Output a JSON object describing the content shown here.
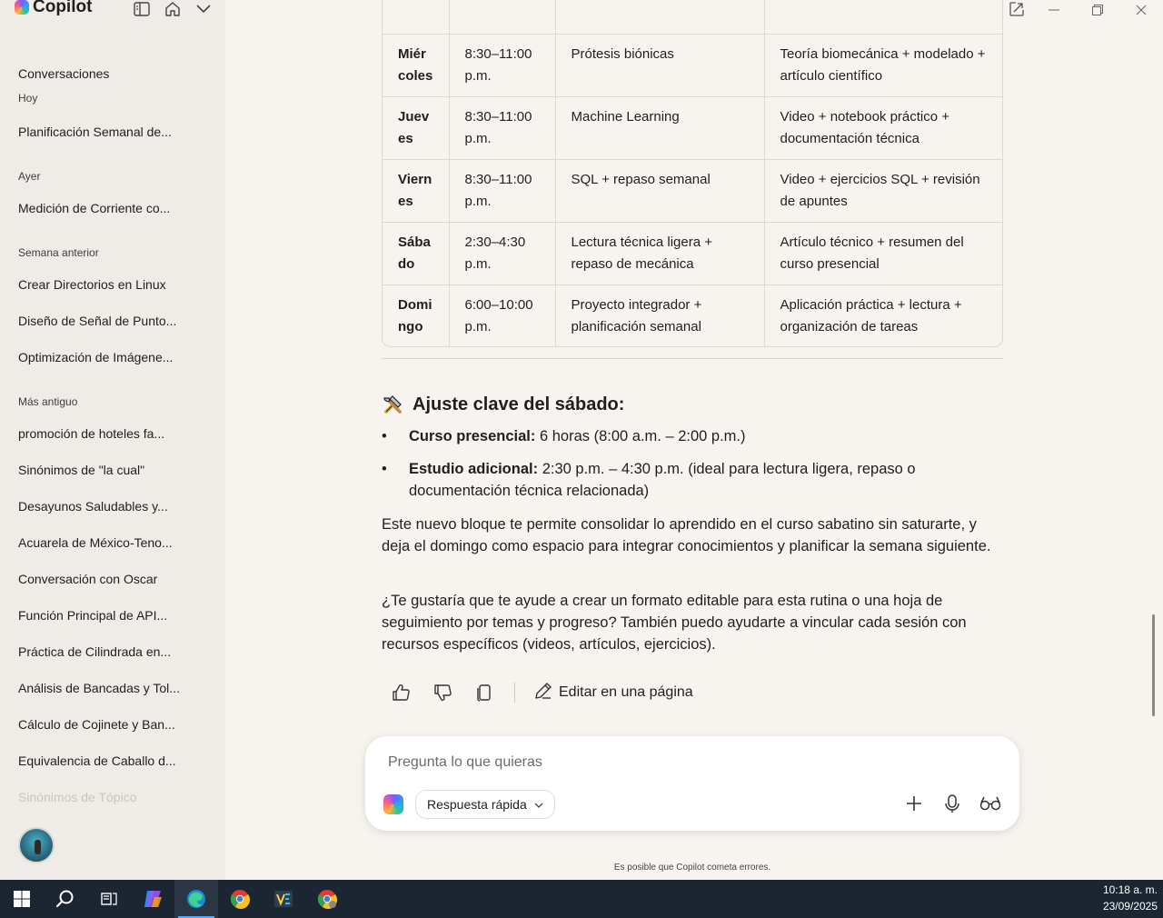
{
  "app": {
    "name": "Copilot"
  },
  "sidebar": {
    "section_title": "Conversaciones",
    "groups": [
      {
        "label": "Hoy",
        "items": [
          "Planificación Semanal de..."
        ]
      },
      {
        "label": "Ayer",
        "items": [
          "Medición de Corriente co..."
        ]
      },
      {
        "label": "Semana anterior",
        "items": [
          "Crear Directorios en Linux",
          "Diseño de Señal de Punto...",
          "Optimización de Imágene..."
        ]
      },
      {
        "label": "Más antiguo",
        "items": [
          "promoción de hoteles fa...",
          "Sinónimos de \"la cual\"",
          "Desayunos Saludables y...",
          "Acuarela de México-Teno...",
          "Conversación con Oscar",
          "Función Principal de API...",
          "Práctica de Cilindrada en...",
          "Análisis de Bancadas y Tol...",
          "Cálculo de Cojinete y Ban...",
          "Equivalencia de Caballo d...",
          "Sinónimos de Tópico"
        ]
      }
    ]
  },
  "schedule": {
    "rows": [
      {
        "day": "Miércoles",
        "time": "8:30–11:00 p.m.",
        "topic": "Prótesis biónicas",
        "resources": "Teoría biomecánica + modelado + artículo científico"
      },
      {
        "day": "Jueves",
        "time": "8:30–11:00 p.m.",
        "topic": "Machine Learning",
        "resources": "Video + notebook práctico + documentación técnica"
      },
      {
        "day": "Viernes",
        "time": "8:30–11:00 p.m.",
        "topic": "SQL + repaso semanal",
        "resources": "Video + ejercicios SQL + revisión de apuntes"
      },
      {
        "day": "Sábado",
        "time": "2:30–4:30 p.m.",
        "topic": "Lectura técnica ligera + repaso de mecánica",
        "resources": "Artículo técnico + resumen del curso presencial"
      },
      {
        "day": "Domingo",
        "time": "6:00–10:00 p.m.",
        "topic": "Proyecto integrador + planificación semanal",
        "resources": "Aplicación práctica + lectura + organización de tareas"
      }
    ]
  },
  "message": {
    "heading": "Ajuste clave del sábado:",
    "bullets": [
      {
        "bold": "Curso presencial:",
        "text": " 6 horas (8:00 a.m. – 2:00 p.m.)"
      },
      {
        "bold": "Estudio adicional:",
        "text": " 2:30 p.m. – 4:30 p.m. (ideal para lectura ligera, repaso o documentación técnica relacionada)"
      }
    ],
    "para1": "Este nuevo bloque te permite consolidar lo aprendido en el curso sabatino sin saturarte, y deja el domingo como espacio para integrar conocimientos y planificar la semana siguiente.",
    "para2": "¿Te gustaría que te ayude a crear un formato editable para esta rutina o una hoja de seguimiento por temas y progreso? También puedo ayudarte a vincular cada sesión con recursos específicos (videos, artículos, ejercicios)."
  },
  "actions": {
    "edit_label": "Editar en una página"
  },
  "composer": {
    "placeholder": "Pregunta lo que quieras",
    "mode_label": "Respuesta rápida",
    "disclaimer": "Es posible que Copilot cometa errores."
  },
  "taskbar": {
    "time": "10:18 a. m.",
    "date": "23/09/2025"
  },
  "icons": [
    "sidebar-toggle-icon",
    "home-icon",
    "chevron-down-icon",
    "popout-icon",
    "minimize-icon",
    "restore-icon",
    "close-icon",
    "tools-icon",
    "thumbs-up-icon",
    "thumbs-down-icon",
    "copy-icon",
    "pencil-icon",
    "plus-icon",
    "microphone-icon",
    "glasses-icon"
  ]
}
